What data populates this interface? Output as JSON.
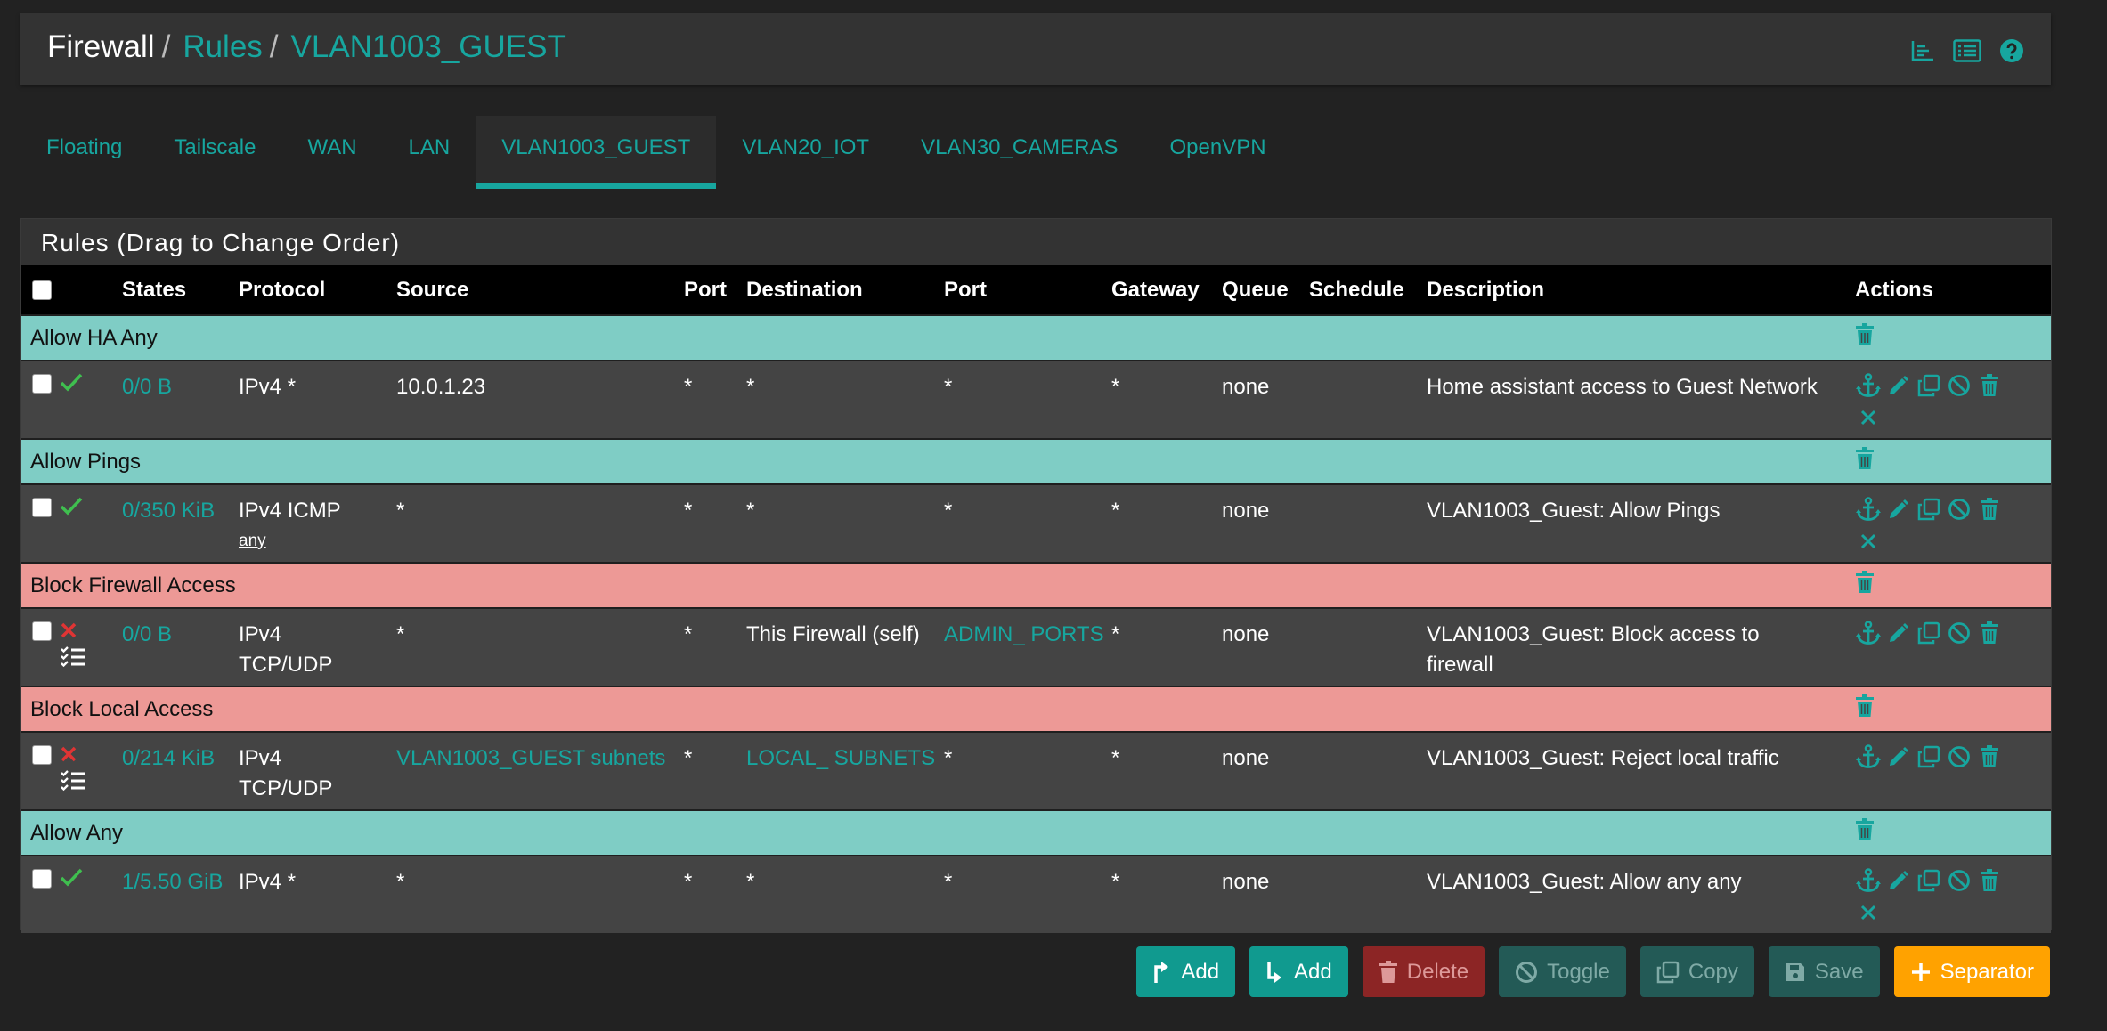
{
  "breadcrumb": {
    "root": "Firewall",
    "separator": "/",
    "level2": "Rules",
    "level3": "VLAN1003_GUEST"
  },
  "tabs": [
    {
      "label": "Floating",
      "active": false
    },
    {
      "label": "Tailscale",
      "active": false
    },
    {
      "label": "WAN",
      "active": false
    },
    {
      "label": "LAN",
      "active": false
    },
    {
      "label": "VLAN1003_GUEST",
      "active": true
    },
    {
      "label": "VLAN20_IOT",
      "active": false
    },
    {
      "label": "VLAN30_CAMERAS",
      "active": false
    },
    {
      "label": "OpenVPN",
      "active": false
    }
  ],
  "panel": {
    "title": "Rules (Drag to Change Order)",
    "columns": {
      "states": "States",
      "protocol": "Protocol",
      "source": "Source",
      "port": "Port",
      "destination": "Destination",
      "dport": "Port",
      "gateway": "Gateway",
      "queue": "Queue",
      "schedule": "Schedule",
      "description": "Description",
      "actions": "Actions"
    }
  },
  "groups": [
    {
      "separator": "Allow HA Any",
      "sep_color": "teal",
      "rule": {
        "action": "pass",
        "states": "0/0 B",
        "protocol": "IPv4 *",
        "protocol_sub": "",
        "source": "10.0.1.23",
        "source_link": false,
        "port": "*",
        "destination": "*",
        "dest_link": false,
        "dport": "*",
        "dport_link": false,
        "gateway": "*",
        "queue": "none",
        "schedule": "",
        "description": "Home assistant access to Guest Network"
      }
    },
    {
      "separator": "Allow Pings",
      "sep_color": "teal",
      "rule": {
        "action": "pass",
        "states": "0/350 KiB",
        "protocol": "IPv4 ICMP",
        "protocol_sub": "any",
        "source": "*",
        "source_link": false,
        "port": "*",
        "destination": "*",
        "dest_link": false,
        "dport": "*",
        "dport_link": false,
        "gateway": "*",
        "queue": "none",
        "schedule": "",
        "description": "VLAN1003_Guest: Allow Pings"
      }
    },
    {
      "separator": "Block Firewall Access",
      "sep_color": "red",
      "rule": {
        "action": "block",
        "states": "0/0 B",
        "protocol": "IPv4 TCP/UDP",
        "protocol_sub": "",
        "source": "*",
        "source_link": false,
        "port": "*",
        "destination": "This Firewall (self)",
        "dest_link": false,
        "dport": "ADMIN_ PORTS",
        "dport_link": true,
        "gateway": "*",
        "queue": "none",
        "schedule": "",
        "description": "VLAN1003_Guest: Block access to firewall"
      }
    },
    {
      "separator": "Block Local Access",
      "sep_color": "red",
      "rule": {
        "action": "block",
        "states": "0/214 KiB",
        "protocol": "IPv4 TCP/UDP",
        "protocol_sub": "",
        "source": "VLAN1003_GUEST subnets",
        "source_link": true,
        "port": "*",
        "destination": "LOCAL_ SUBNETS",
        "dest_link": true,
        "dport": "*",
        "dport_link": false,
        "gateway": "*",
        "queue": "none",
        "schedule": "",
        "description": "VLAN1003_Guest: Reject local traffic"
      }
    },
    {
      "separator": "Allow Any",
      "sep_color": "teal",
      "rule": {
        "action": "pass",
        "states": "1/5.50 GiB",
        "protocol": "IPv4 *",
        "protocol_sub": "",
        "source": "*",
        "source_link": false,
        "port": "*",
        "destination": "*",
        "dest_link": false,
        "dport": "*",
        "dport_link": false,
        "gateway": "*",
        "queue": "none",
        "schedule": "",
        "description": "VLAN1003_Guest: Allow any any"
      }
    }
  ],
  "buttons": {
    "add_top": "Add",
    "add_bottom": "Add",
    "delete": "Delete",
    "toggle": "Toggle",
    "copy": "Copy",
    "save": "Save",
    "separator": "Separator"
  },
  "colors": {
    "accent": "#17a69f",
    "separator_teal": "#7fcdc5",
    "separator_red": "#ed9996",
    "pass_check": "#3fbf4f",
    "block_x": "#e03434",
    "separator_button": "#ffa200"
  }
}
